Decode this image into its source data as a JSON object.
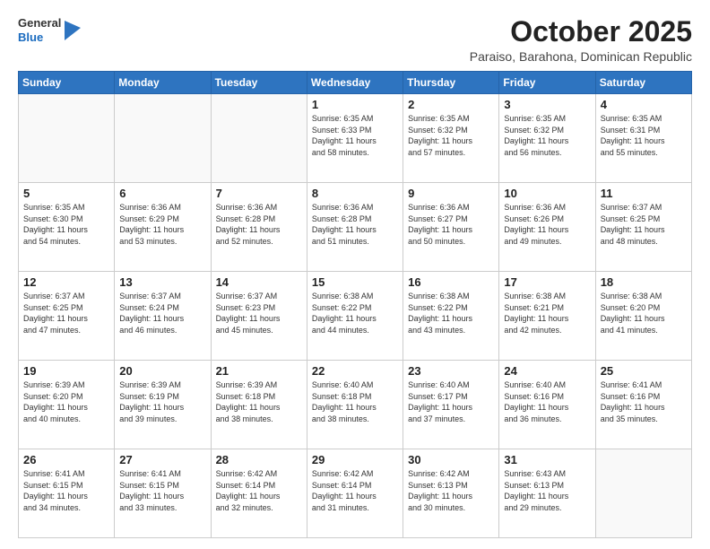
{
  "logo": {
    "general": "General",
    "blue": "Blue"
  },
  "title": "October 2025",
  "subtitle": "Paraiso, Barahona, Dominican Republic",
  "headers": [
    "Sunday",
    "Monday",
    "Tuesday",
    "Wednesday",
    "Thursday",
    "Friday",
    "Saturday"
  ],
  "weeks": [
    [
      {
        "day": "",
        "info": ""
      },
      {
        "day": "",
        "info": ""
      },
      {
        "day": "",
        "info": ""
      },
      {
        "day": "1",
        "info": "Sunrise: 6:35 AM\nSunset: 6:33 PM\nDaylight: 11 hours\nand 58 minutes."
      },
      {
        "day": "2",
        "info": "Sunrise: 6:35 AM\nSunset: 6:32 PM\nDaylight: 11 hours\nand 57 minutes."
      },
      {
        "day": "3",
        "info": "Sunrise: 6:35 AM\nSunset: 6:32 PM\nDaylight: 11 hours\nand 56 minutes."
      },
      {
        "day": "4",
        "info": "Sunrise: 6:35 AM\nSunset: 6:31 PM\nDaylight: 11 hours\nand 55 minutes."
      }
    ],
    [
      {
        "day": "5",
        "info": "Sunrise: 6:35 AM\nSunset: 6:30 PM\nDaylight: 11 hours\nand 54 minutes."
      },
      {
        "day": "6",
        "info": "Sunrise: 6:36 AM\nSunset: 6:29 PM\nDaylight: 11 hours\nand 53 minutes."
      },
      {
        "day": "7",
        "info": "Sunrise: 6:36 AM\nSunset: 6:28 PM\nDaylight: 11 hours\nand 52 minutes."
      },
      {
        "day": "8",
        "info": "Sunrise: 6:36 AM\nSunset: 6:28 PM\nDaylight: 11 hours\nand 51 minutes."
      },
      {
        "day": "9",
        "info": "Sunrise: 6:36 AM\nSunset: 6:27 PM\nDaylight: 11 hours\nand 50 minutes."
      },
      {
        "day": "10",
        "info": "Sunrise: 6:36 AM\nSunset: 6:26 PM\nDaylight: 11 hours\nand 49 minutes."
      },
      {
        "day": "11",
        "info": "Sunrise: 6:37 AM\nSunset: 6:25 PM\nDaylight: 11 hours\nand 48 minutes."
      }
    ],
    [
      {
        "day": "12",
        "info": "Sunrise: 6:37 AM\nSunset: 6:25 PM\nDaylight: 11 hours\nand 47 minutes."
      },
      {
        "day": "13",
        "info": "Sunrise: 6:37 AM\nSunset: 6:24 PM\nDaylight: 11 hours\nand 46 minutes."
      },
      {
        "day": "14",
        "info": "Sunrise: 6:37 AM\nSunset: 6:23 PM\nDaylight: 11 hours\nand 45 minutes."
      },
      {
        "day": "15",
        "info": "Sunrise: 6:38 AM\nSunset: 6:22 PM\nDaylight: 11 hours\nand 44 minutes."
      },
      {
        "day": "16",
        "info": "Sunrise: 6:38 AM\nSunset: 6:22 PM\nDaylight: 11 hours\nand 43 minutes."
      },
      {
        "day": "17",
        "info": "Sunrise: 6:38 AM\nSunset: 6:21 PM\nDaylight: 11 hours\nand 42 minutes."
      },
      {
        "day": "18",
        "info": "Sunrise: 6:38 AM\nSunset: 6:20 PM\nDaylight: 11 hours\nand 41 minutes."
      }
    ],
    [
      {
        "day": "19",
        "info": "Sunrise: 6:39 AM\nSunset: 6:20 PM\nDaylight: 11 hours\nand 40 minutes."
      },
      {
        "day": "20",
        "info": "Sunrise: 6:39 AM\nSunset: 6:19 PM\nDaylight: 11 hours\nand 39 minutes."
      },
      {
        "day": "21",
        "info": "Sunrise: 6:39 AM\nSunset: 6:18 PM\nDaylight: 11 hours\nand 38 minutes."
      },
      {
        "day": "22",
        "info": "Sunrise: 6:40 AM\nSunset: 6:18 PM\nDaylight: 11 hours\nand 38 minutes."
      },
      {
        "day": "23",
        "info": "Sunrise: 6:40 AM\nSunset: 6:17 PM\nDaylight: 11 hours\nand 37 minutes."
      },
      {
        "day": "24",
        "info": "Sunrise: 6:40 AM\nSunset: 6:16 PM\nDaylight: 11 hours\nand 36 minutes."
      },
      {
        "day": "25",
        "info": "Sunrise: 6:41 AM\nSunset: 6:16 PM\nDaylight: 11 hours\nand 35 minutes."
      }
    ],
    [
      {
        "day": "26",
        "info": "Sunrise: 6:41 AM\nSunset: 6:15 PM\nDaylight: 11 hours\nand 34 minutes."
      },
      {
        "day": "27",
        "info": "Sunrise: 6:41 AM\nSunset: 6:15 PM\nDaylight: 11 hours\nand 33 minutes."
      },
      {
        "day": "28",
        "info": "Sunrise: 6:42 AM\nSunset: 6:14 PM\nDaylight: 11 hours\nand 32 minutes."
      },
      {
        "day": "29",
        "info": "Sunrise: 6:42 AM\nSunset: 6:14 PM\nDaylight: 11 hours\nand 31 minutes."
      },
      {
        "day": "30",
        "info": "Sunrise: 6:42 AM\nSunset: 6:13 PM\nDaylight: 11 hours\nand 30 minutes."
      },
      {
        "day": "31",
        "info": "Sunrise: 6:43 AM\nSunset: 6:13 PM\nDaylight: 11 hours\nand 29 minutes."
      },
      {
        "day": "",
        "info": ""
      }
    ]
  ]
}
